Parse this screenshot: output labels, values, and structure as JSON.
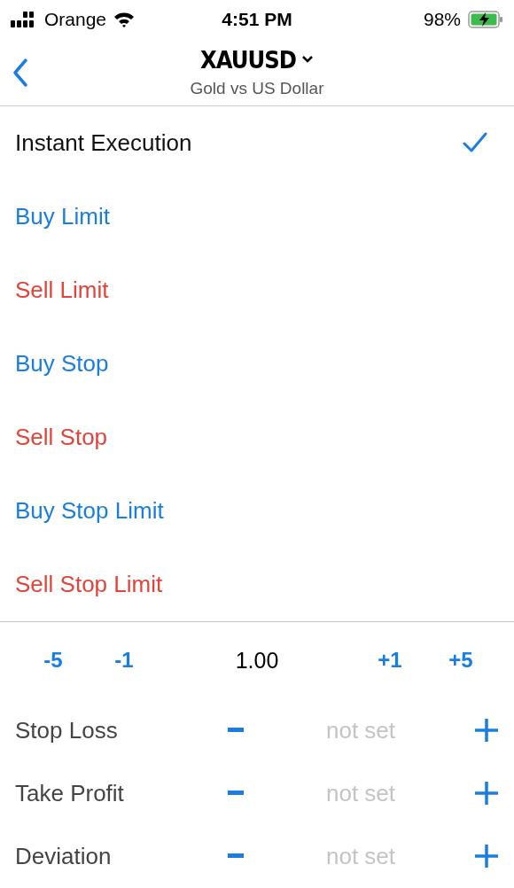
{
  "status_bar": {
    "carrier": "Orange",
    "time": "4:51 PM",
    "battery": "98%"
  },
  "header": {
    "symbol": "XAUUSD",
    "description": "Gold vs US Dollar"
  },
  "order_types": [
    {
      "label": "Instant Execution",
      "kind": "market",
      "selected": true
    },
    {
      "label": "Buy Limit",
      "kind": "buy",
      "selected": false
    },
    {
      "label": "Sell Limit",
      "kind": "sell",
      "selected": false
    },
    {
      "label": "Buy Stop",
      "kind": "buy",
      "selected": false
    },
    {
      "label": "Sell Stop",
      "kind": "sell",
      "selected": false
    },
    {
      "label": "Buy Stop Limit",
      "kind": "buy",
      "selected": false
    },
    {
      "label": "Sell Stop Limit",
      "kind": "sell",
      "selected": false
    }
  ],
  "volume": {
    "decrease": [
      "-5",
      "-1"
    ],
    "value": "1.00",
    "increase": [
      "+1",
      "+5"
    ]
  },
  "levels": [
    {
      "label": "Stop Loss",
      "placeholder": "not set"
    },
    {
      "label": "Take Profit",
      "placeholder": "not set"
    },
    {
      "label": "Deviation",
      "placeholder": "not set"
    }
  ]
}
